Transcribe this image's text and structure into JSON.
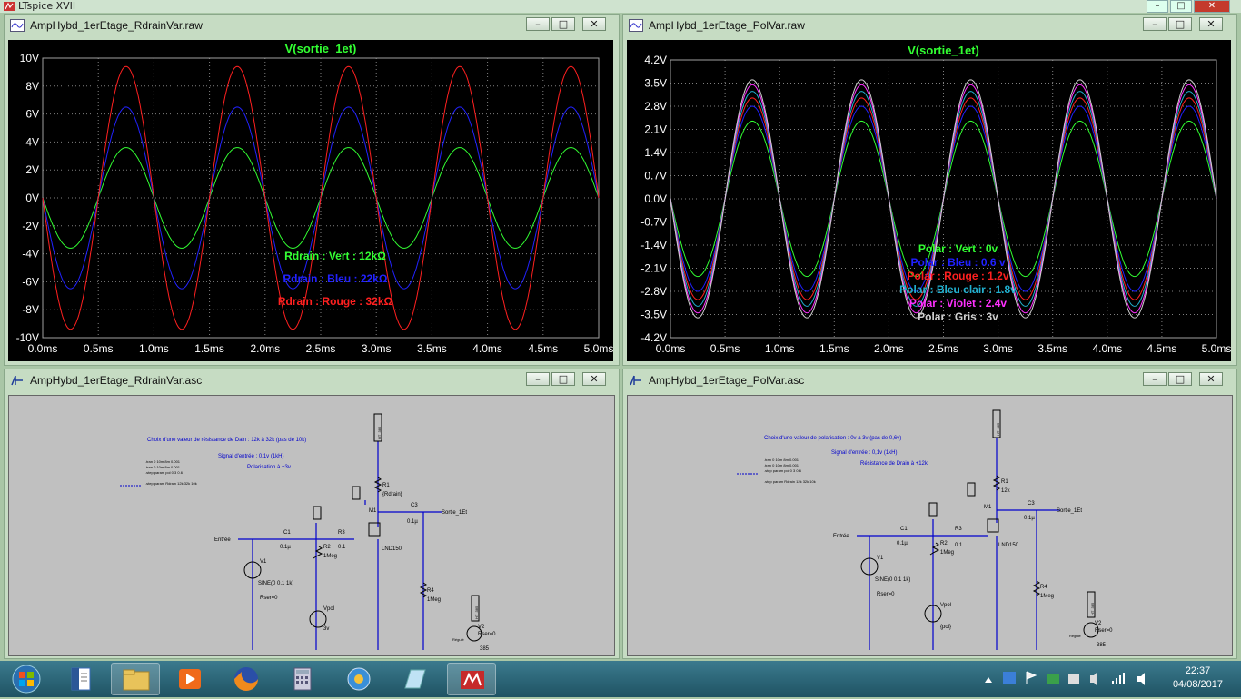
{
  "app": {
    "title": "LTspice XVII"
  },
  "windows": [
    {
      "id": "w1",
      "title": "AmpHybd_1erEtage_RdrainVar.raw",
      "icon": "waveform-icon"
    },
    {
      "id": "w2",
      "title": "AmpHybd_1erEtage_PolVar.raw",
      "icon": "waveform-icon"
    },
    {
      "id": "w3",
      "title": "AmpHybd_1erEtage_RdrainVar.asc",
      "icon": "schematic-icon"
    },
    {
      "id": "w4",
      "title": "AmpHybd_1erEtage_PolVar.asc",
      "icon": "schematic-icon"
    }
  ],
  "window_buttons": {
    "minimize": "–",
    "maximize": "□",
    "close": "✕"
  },
  "chart_data": [
    {
      "type": "line",
      "title": "V(sortie_1et)",
      "x": {
        "ticks": [
          "0.0ms",
          "0.5ms",
          "1.0ms",
          "1.5ms",
          "2.0ms",
          "2.5ms",
          "3.0ms",
          "3.5ms",
          "4.0ms",
          "4.5ms",
          "5.0ms"
        ],
        "range": [
          0,
          5
        ],
        "unit": "ms"
      },
      "y": {
        "ticks": [
          "10V",
          "8V",
          "6V",
          "4V",
          "2V",
          "0V",
          "-2V",
          "-4V",
          "-6V",
          "-8V",
          "-10V"
        ],
        "range": [
          -10,
          10
        ]
      },
      "signal": {
        "frequency_khz": 1,
        "phase": "inverted"
      },
      "series": [
        {
          "name": "Rdrain : Vert : 12kΩ",
          "color": "#32ff32",
          "amplitude": 3.6
        },
        {
          "name": "Rdrain : Bleu : 22kΩ",
          "color": "#2222ff",
          "amplitude": 6.5
        },
        {
          "name": "Rdrain : Rouge : 32kΩ",
          "color": "#ff2020",
          "amplitude": 9.4
        }
      ],
      "grid": true,
      "legend_placement": "center"
    },
    {
      "type": "line",
      "title": "V(sortie_1et)",
      "x": {
        "ticks": [
          "0.0ms",
          "0.5ms",
          "1.0ms",
          "1.5ms",
          "2.0ms",
          "2.5ms",
          "3.0ms",
          "3.5ms",
          "4.0ms",
          "4.5ms",
          "5.0ms"
        ],
        "range": [
          0,
          5
        ],
        "unit": "ms"
      },
      "y": {
        "ticks": [
          "4.2V",
          "3.5V",
          "2.8V",
          "2.1V",
          "1.4V",
          "0.7V",
          "0.0V",
          "-0.7V",
          "-1.4V",
          "-2.1V",
          "-2.8V",
          "-3.5V",
          "-4.2V"
        ],
        "range": [
          -4.2,
          4.2
        ]
      },
      "signal": {
        "frequency_khz": 1,
        "phase": "inverted"
      },
      "series": [
        {
          "name": "Polar : Vert : 0v",
          "color": "#32ff32",
          "amplitude": 2.35
        },
        {
          "name": "Polar : Bleu : 0.6 v",
          "color": "#2020ff",
          "amplitude": 2.8
        },
        {
          "name": "Polar : Rouge : 1.2v",
          "color": "#ff2020",
          "amplitude": 3.05
        },
        {
          "name": "Polar : Bleu clair : 1.8v",
          "color": "#20b0d0",
          "amplitude": 3.25
        },
        {
          "name": "Polar : Violet : 2.4v",
          "color": "#ff30ff",
          "amplitude": 3.45
        },
        {
          "name": "Polar : Gris : 3v",
          "color": "#d0d0d0",
          "amplitude": 3.6
        }
      ],
      "grid": true,
      "legend_placement": "center"
    }
  ],
  "schematic_left": {
    "notes": [
      "Choix d'une valeur de résistance de Dain : 12k à 32k (pas de 10k)",
      "Signal d'entrée : 0,1v (1kH)",
      "Polarisation à +3v"
    ],
    "directives": [
      ".tran 0 10m 8m 0.001",
      ".tran 0 10m 8m 0.001",
      ".step param pol 0 3 0.6",
      ".step param Rdrain 12k 32k 10k"
    ],
    "labels": {
      "net_in": "Entrée",
      "net_out": "Sortie_1Et",
      "hv": "HT_385",
      "hv2": "HT_385",
      "r1": "R1",
      "r1v": "{Rdrain}",
      "r2": "R2",
      "r2v": "1Meg",
      "r3": "R3",
      "r3v": "0.1",
      "r4": "R4",
      "r4v": "1Meg",
      "c1": "C1",
      "c1v": "0.1µ",
      "c3": "C3",
      "c3v": "0.1µ",
      "m1": "M1",
      "m1v": "LND150",
      "v1": "V1",
      "v1v": "SINE(0 0.1 1k)",
      "rser": "Rser=0",
      "vpol": "Vpol",
      "vpolv": "3v",
      "v2": "V2",
      "v2r": "Rser=0",
      "v2v": "385",
      "small": "Régulé"
    }
  },
  "schematic_right": {
    "notes": [
      "Choix d'une valeur de polarisation : 0v à 3v (pas de 0,6v)",
      "Signal d'entrée : 0,1v (1kH)",
      "Résistance de Drain à +12k"
    ],
    "directives": [
      ".tran 0 10m 8m 0.001",
      ".tran 0 10m 8m 0.001",
      ".step param pol 0 3 0.6",
      ".step param Rdrain 12k 32k 10k"
    ],
    "labels": {
      "net_in": "Entrée",
      "net_out": "Sortie_1Et",
      "hv": "HT_385",
      "hv2": "HT_385",
      "r1": "R1",
      "r1v": "12k",
      "r2": "R2",
      "r2v": "1Meg",
      "r3": "R3",
      "r3v": "0.1",
      "r4": "R4",
      "r4v": "1Meg",
      "c1": "C1",
      "c1v": "0.1µ",
      "c3": "C3",
      "c3v": "0.1µ",
      "m1": "M1",
      "m1v": "LND150",
      "v1": "V1",
      "v1v": "SINE(0 0.1 1k)",
      "rser": "Rser=0",
      "vpol": "Vpol",
      "vpolv": "{pol}",
      "v2": "V2",
      "v2r": "Rser=0",
      "v2v": "385",
      "small": "Régulé"
    }
  },
  "taskbar": {
    "items": [
      {
        "name": "start-button",
        "icon": "windows-orb-icon"
      },
      {
        "name": "taskbar-word",
        "icon": "document-icon"
      },
      {
        "name": "taskbar-explorer",
        "icon": "folder-icon"
      },
      {
        "name": "taskbar-media",
        "icon": "media-player-icon"
      },
      {
        "name": "taskbar-firefox",
        "icon": "firefox-icon"
      },
      {
        "name": "taskbar-calculator",
        "icon": "calculator-icon"
      },
      {
        "name": "taskbar-app",
        "icon": "globe-icon"
      },
      {
        "name": "taskbar-notepad",
        "icon": "notepad-icon"
      },
      {
        "name": "taskbar-ltspice",
        "icon": "ltspice-icon"
      }
    ],
    "time": "22:37",
    "date": "04/08/2017"
  }
}
